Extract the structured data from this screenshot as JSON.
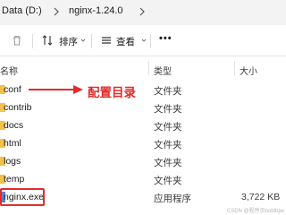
{
  "address_bar": {
    "crumbs": [
      "Data (D:)",
      "nginx-1.24.0"
    ]
  },
  "toolbar": {
    "delete_icon": "trash-icon",
    "sort_label": "排序",
    "view_label": "查看",
    "more_label": "•••"
  },
  "columns": {
    "name": "名称",
    "type": "类型",
    "size": "大小"
  },
  "files": [
    {
      "name": "conf",
      "type": "文件夹",
      "size": "",
      "kind": "folder"
    },
    {
      "name": "contrib",
      "type": "文件夹",
      "size": "",
      "kind": "folder"
    },
    {
      "name": "docs",
      "type": "文件夹",
      "size": "",
      "kind": "folder"
    },
    {
      "name": "html",
      "type": "文件夹",
      "size": "",
      "kind": "folder"
    },
    {
      "name": "logs",
      "type": "文件夹",
      "size": "",
      "kind": "folder"
    },
    {
      "name": "temp",
      "type": "文件夹",
      "size": "",
      "kind": "folder"
    },
    {
      "name": "nginx.exe",
      "type": "应用程序",
      "size": "3,722 KB",
      "kind": "exe"
    }
  ],
  "annotation": {
    "text": "配置目录",
    "color": "#e32b2b"
  },
  "watermark": "CSDN @程序员boblbpe"
}
